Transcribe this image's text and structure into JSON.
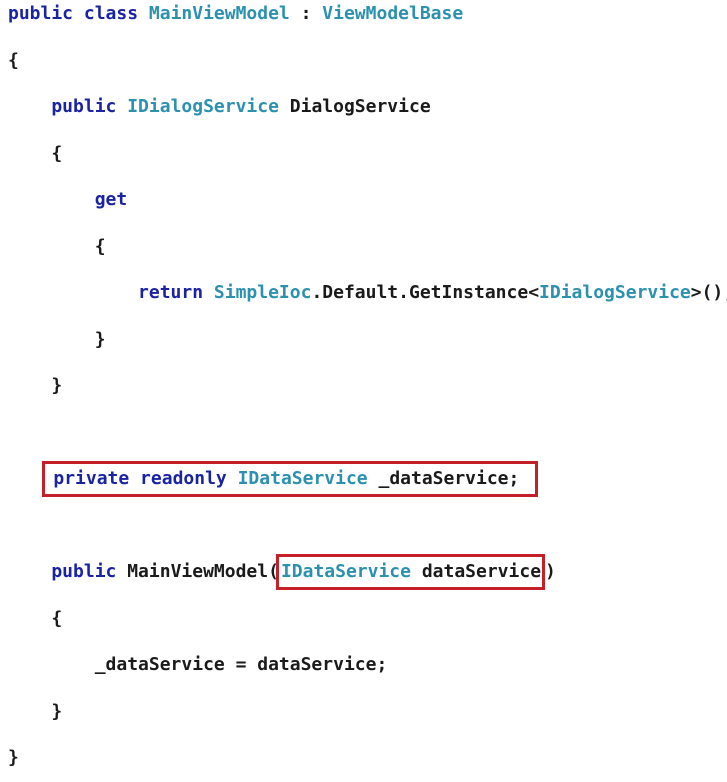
{
  "code": {
    "lines": [
      {
        "tokens": [
          {
            "t": "public class ",
            "c": "kw"
          },
          {
            "t": "MainViewModel",
            "c": "type"
          },
          {
            "t": " : ",
            "c": "plain"
          },
          {
            "t": "ViewModelBase",
            "c": "type"
          }
        ]
      },
      {
        "tokens": [
          {
            "t": "{",
            "c": "plain"
          }
        ]
      },
      {
        "tokens": [
          {
            "t": "    public ",
            "c": "kw"
          },
          {
            "t": "IDialogService",
            "c": "type"
          },
          {
            "t": " DialogService",
            "c": "plain"
          }
        ]
      },
      {
        "tokens": [
          {
            "t": "    {",
            "c": "plain"
          }
        ]
      },
      {
        "tokens": [
          {
            "t": "        get",
            "c": "kw"
          }
        ]
      },
      {
        "tokens": [
          {
            "t": "        {",
            "c": "plain"
          }
        ]
      },
      {
        "tokens": [
          {
            "t": "            return ",
            "c": "kw"
          },
          {
            "t": "SimpleIoc",
            "c": "type"
          },
          {
            "t": ".Default.GetInstance<",
            "c": "plain"
          },
          {
            "t": "IDialogService",
            "c": "type"
          },
          {
            "t": ">();",
            "c": "plain"
          }
        ]
      },
      {
        "tokens": [
          {
            "t": "        }",
            "c": "plain"
          }
        ]
      },
      {
        "tokens": [
          {
            "t": "    }",
            "c": "plain"
          }
        ]
      },
      {
        "tokens": []
      },
      {
        "highlight": "field",
        "prefix": "    ",
        "tokens": [
          {
            "t": "private readonly ",
            "c": "kw"
          },
          {
            "t": "IDataService",
            "c": "type"
          },
          {
            "t": " _dataService;",
            "c": "plain"
          }
        ]
      },
      {
        "tokens": []
      },
      {
        "tokens": [
          {
            "t": "    public ",
            "c": "kw"
          },
          {
            "t": "MainViewModel(",
            "c": "plain"
          }
        ],
        "param": [
          {
            "t": "IDataService",
            "c": "type"
          },
          {
            "t": " dataService",
            "c": "plain"
          }
        ],
        "suffix": [
          {
            "t": ")",
            "c": "plain"
          }
        ]
      },
      {
        "tokens": [
          {
            "t": "    {",
            "c": "plain"
          }
        ]
      },
      {
        "tokens": [
          {
            "t": "        _dataService = dataService;",
            "c": "plain"
          }
        ]
      },
      {
        "tokens": [
          {
            "t": "    }",
            "c": "plain"
          }
        ]
      },
      {
        "tokens": [
          {
            "t": "}",
            "c": "plain"
          }
        ]
      }
    ]
  },
  "colors": {
    "keyword": "#1a23a3",
    "type": "#2b91af",
    "plain": "#1a1a1a",
    "highlight_box": "#c4202a"
  }
}
